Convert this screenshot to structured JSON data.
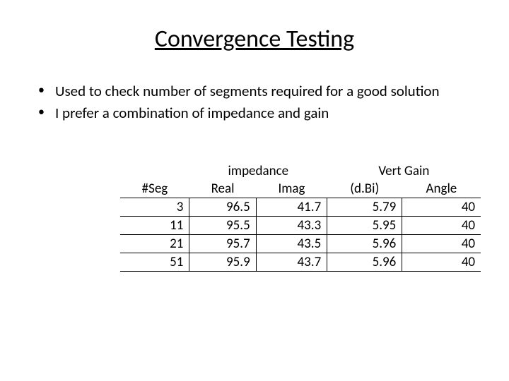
{
  "title": "Convergence Testing",
  "bullets": [
    "Used to check number of segments required for a good solution",
    "I prefer a combination of impedance and gain"
  ],
  "table": {
    "group_headers": {
      "impedance": "impedance",
      "vert_gain": "Vert Gain"
    },
    "sub_headers": {
      "seg": "#Seg",
      "real": "Real",
      "imag": "Imag",
      "dbi": "(d.Bi)",
      "angle": "Angle"
    },
    "rows": [
      {
        "seg": "3",
        "real": "96.5",
        "imag": "41.7",
        "dbi": "5.79",
        "angle": "40"
      },
      {
        "seg": "11",
        "real": "95.5",
        "imag": "43.3",
        "dbi": "5.95",
        "angle": "40"
      },
      {
        "seg": "21",
        "real": "95.7",
        "imag": "43.5",
        "dbi": "5.96",
        "angle": "40"
      },
      {
        "seg": "51",
        "real": "95.9",
        "imag": "43.7",
        "dbi": "5.96",
        "angle": "40"
      }
    ]
  },
  "chart_data": {
    "type": "table",
    "title": "Convergence Testing",
    "columns": [
      "#Seg",
      "impedance Real",
      "impedance Imag",
      "Vert Gain (d.Bi)",
      "Vert Gain Angle"
    ],
    "rows": [
      [
        3,
        96.5,
        41.7,
        5.79,
        40
      ],
      [
        11,
        95.5,
        43.3,
        5.95,
        40
      ],
      [
        21,
        95.7,
        43.5,
        5.96,
        40
      ],
      [
        51,
        95.9,
        43.7,
        5.96,
        40
      ]
    ]
  }
}
